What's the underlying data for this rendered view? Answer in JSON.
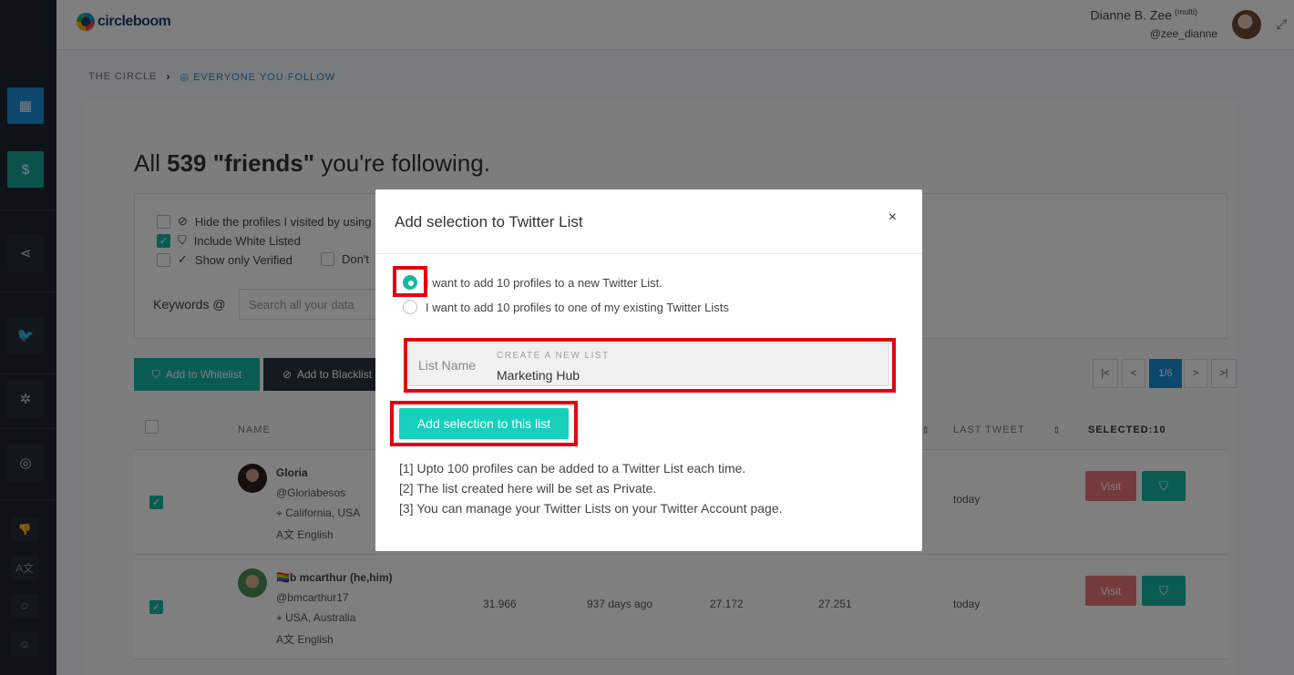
{
  "brand": {
    "name": "circleboom"
  },
  "user": {
    "name": "Dianne B. Zee",
    "badge": "(multi)",
    "handle": "@zee_dianne"
  },
  "breadcrumb": {
    "root": "THE CIRCLE",
    "current": "EVERYONE YOU FOLLOW"
  },
  "heading": {
    "prefix": "All ",
    "count": "539",
    "mid": " \"friends\"",
    "suffix": " you're following."
  },
  "filters": {
    "hide_visited": "Hide the profiles I visited by using",
    "include_whitelisted": "Include White Listed",
    "only_verified": "Show only Verified",
    "dont": "Don't",
    "keywords_label": "Keywords",
    "search_placeholder": "Search all your data"
  },
  "actions": {
    "whitelist": "Add to Whitelist",
    "blacklist": "Add to Blacklist"
  },
  "pagination": {
    "first": "|<",
    "prev": "<",
    "current": "1/6",
    "next": ">",
    "last": ">|"
  },
  "table": {
    "headers": {
      "name": "NAME",
      "last_tweet": "LAST TWEET",
      "selected": "SELECTED:10"
    },
    "rows": [
      {
        "name": "Gloria",
        "handle": "@Gloriabesos",
        "location": "California, USA",
        "language": "English",
        "c1": "",
        "c2": "",
        "c3": "",
        "c4": "",
        "last_tweet": "today",
        "visit": "Visit"
      },
      {
        "name": "🏳️‍🌈b mcarthur (he,him)",
        "handle": "@bmcarthur17",
        "location": "USA, Australia",
        "language": "English",
        "c1": "31.966",
        "c2": "937 days ago",
        "c3": "27.172",
        "c4": "27.251",
        "last_tweet": "today",
        "visit": "Visit"
      }
    ]
  },
  "modal": {
    "title": "Add selection to Twitter List",
    "close": "×",
    "option_new": "I want to add 10 profiles to a new Twitter List.",
    "option_existing": "I want to add 10 profiles to one of my existing Twitter Lists",
    "list_name_label": "List Name",
    "create_new_label": "CREATE A NEW LIST",
    "list_name_value": "Marketing Hub",
    "submit": "Add selection to this list",
    "notes": [
      "[1] Upto 100 profiles can be added to a Twitter List each time.",
      "[2] The list created here will be set as Private.",
      "[3] You can manage your Twitter Lists on your Twitter Account page."
    ]
  },
  "colors": {
    "accent": "#15b8a6",
    "primary": "#1b8fd8",
    "highlight": "#e30010",
    "danger": "#ea7478"
  }
}
